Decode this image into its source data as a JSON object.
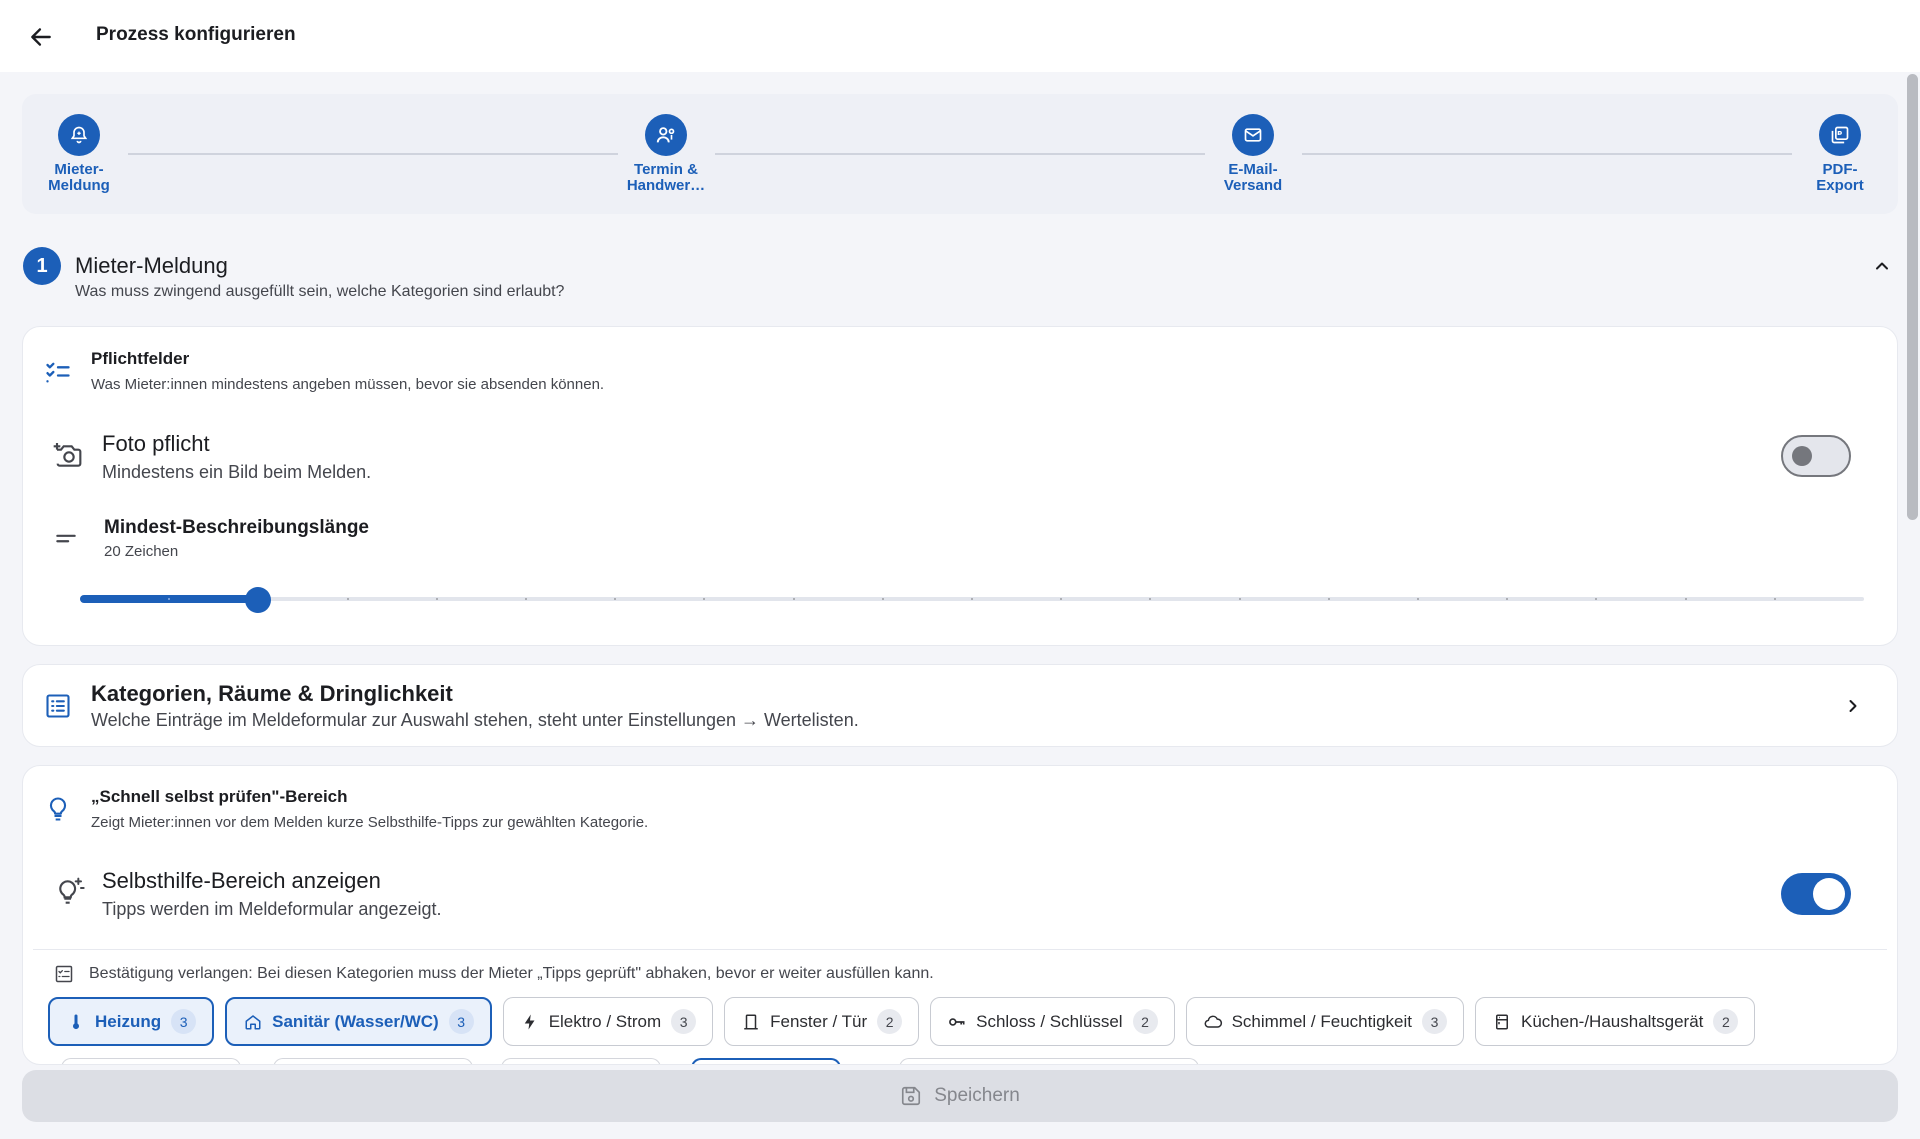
{
  "appbar": {
    "title": "Prozess konfigurieren"
  },
  "stepper": {
    "steps": [
      {
        "label": "Mieter-\nMeldung",
        "icon": "bell-icon"
      },
      {
        "label": "Termin &\nHandwer…",
        "icon": "worker-icon"
      },
      {
        "label": "E-Mail-\nVersand",
        "icon": "mail-icon"
      },
      {
        "label": "PDF-\nExport",
        "icon": "pdf-icon"
      }
    ]
  },
  "section": {
    "number": "1",
    "title": "Mieter-Meldung",
    "subtitle": "Was muss zwingend ausgefüllt sein, welche Kategorien sind erlaubt?"
  },
  "pflichtfelder": {
    "title": "Pflichtfelder",
    "subtitle": "Was Mieter:innen mindestens angeben müssen, bevor sie absenden können.",
    "foto": {
      "title": "Foto pflicht",
      "subtitle": "Mindestens ein Bild beim Melden.",
      "enabled": false
    },
    "mindest": {
      "title": "Mindest-Beschreibungslänge",
      "value_label": "20 Zeichen",
      "fraction": 0.1,
      "steps": 20
    }
  },
  "kategorien": {
    "title": "Kategorien, Räume & Dringlichkeit",
    "subtitle": "Welche Einträge im Meldeformular zur Auswahl stehen, steht unter Einstellungen → Wertelisten."
  },
  "schnell": {
    "title": "„Schnell selbst prüfen\"-Bereich",
    "subtitle": "Zeigt Mieter:innen vor dem Melden kurze Selbsthilfe-Tipps zur gewählten Kategorie.",
    "selbsthilfe": {
      "title": "Selbsthilfe-Bereich anzeigen",
      "subtitle": "Tipps werden im Meldeformular angezeigt.",
      "enabled": true
    },
    "bestaetigung": "Bestätigung verlangen: Bei diesen Kategorien muss der Mieter „Tipps geprüft\" abhaken, bevor er weiter ausfüllen kann.",
    "chips": [
      {
        "label": "Heizung",
        "count": "3",
        "selected": true,
        "icon": "thermometer-icon"
      },
      {
        "label": "Sanitär (Wasser/WC)",
        "count": "3",
        "selected": true,
        "icon": "home-icon"
      },
      {
        "label": "Elektro / Strom",
        "count": "3",
        "selected": false,
        "icon": "bolt-icon"
      },
      {
        "label": "Fenster / Tür",
        "count": "2",
        "selected": false,
        "icon": "door-icon"
      },
      {
        "label": "Schloss / Schlüssel",
        "count": "2",
        "selected": false,
        "icon": "key-icon"
      },
      {
        "label": "Schimmel / Feuchtigkeit",
        "count": "3",
        "selected": false,
        "icon": "cloud-icon"
      },
      {
        "label": "Küchen-/Haushaltsgerät",
        "count": "2",
        "selected": false,
        "icon": "appliance-icon"
      }
    ]
  },
  "savebar": {
    "label": "Speichern"
  }
}
